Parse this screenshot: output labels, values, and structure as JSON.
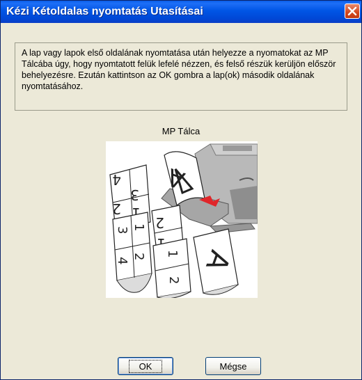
{
  "window": {
    "title": "Kézi Kétoldalas nyomtatás Utasításai",
    "close_icon": "close-icon"
  },
  "instructions": {
    "text": "A lap vagy lapok első oldalának nyomtatása után helyezze a nyomatokat az MP Tálcába úgy, hogy nyomtatott felük lefelé nézzen, és felső részük kerüljön először behelyezésre. Ezután kattintson az OK gombra a lap(ok) második oldalának nyomtatásához."
  },
  "tray": {
    "label": "MP Tálca"
  },
  "illustration": {
    "page_letter": "A",
    "sheet_numbers": [
      "4",
      "3",
      "2",
      "1"
    ],
    "accent_color": "#e0262a"
  },
  "buttons": {
    "ok": "OK",
    "cancel": "Mégse"
  }
}
